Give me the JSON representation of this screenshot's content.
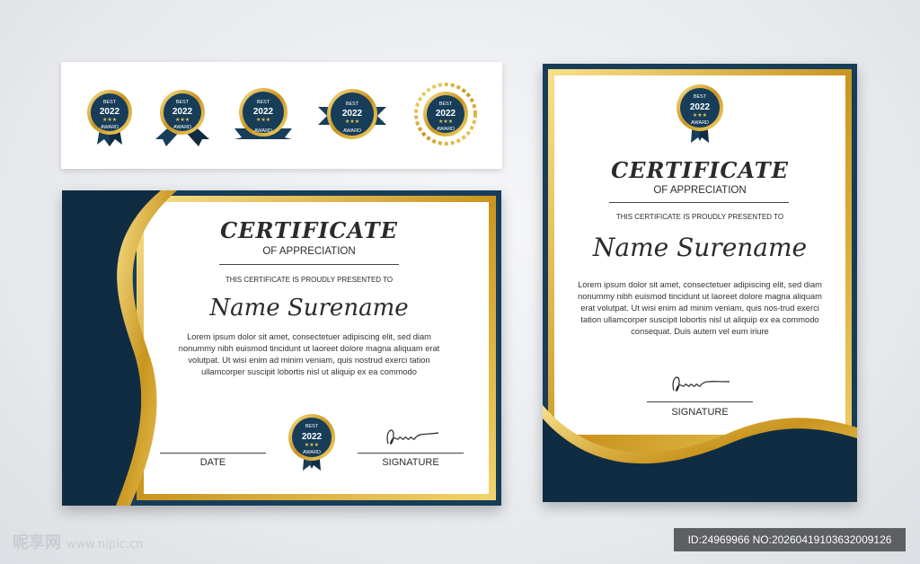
{
  "badge": {
    "top": "BEST",
    "year": "2022",
    "bottom": "AWARD"
  },
  "landscape": {
    "title": "CERTIFICATE",
    "subtitle": "OF APPRECIATION",
    "presented": "THIS CERTIFICATE IS PROUDLY PRESENTED TO",
    "name": "Name Surename",
    "body": "Lorem ipsum dolor sit amet, consectetuer adipiscing elit, sed diam nonummy nibh euismod tincidunt ut laoreet dolore magna aliquam erat volutpat. Ut wisi enim ad minim veniam, quis nostrud exerci tation ullamcorper suscipit lobortis nisl ut aliquip ex ea commodo",
    "date_label": "DATE",
    "signature_label": "SIGNATURE"
  },
  "portrait": {
    "title": "CERTIFICATE",
    "subtitle": "OF APPRECIATION",
    "presented": "THIS CERTIFICATE IS PROUDLY PRESENTED TO",
    "name": "Name Surename",
    "body": "Lorem ipsum dolor sit amet, consectetuer adipiscing elit, sed diam nonummy nibh euismod tincidunt ut laoreet dolore magna aliquam erat volutpat. Ut wisi enim ad minim veniam, quis nos-trud exerci tation ullamcorper suscipit lobortis nisl ut aliquip ex ea commodo consequat. Duis autem vel eum iriure",
    "signature_label": "SIGNATURE"
  },
  "watermark": {
    "site": "昵享网",
    "url": "www.nipic.cn",
    "id_text": "ID:24969966 NO:20260419103632009126"
  },
  "colors": {
    "navy": "#173d59",
    "gold": "#d4a82a",
    "gold_light": "#f6e08a",
    "paper": "#ffffff"
  }
}
